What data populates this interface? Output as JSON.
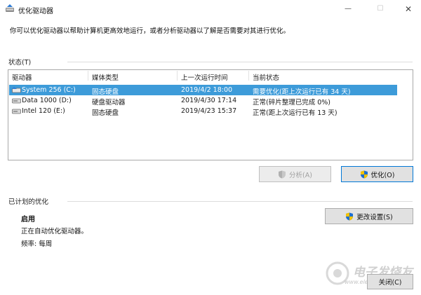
{
  "window": {
    "title": "优化驱动器",
    "controls": {
      "minimize": "—",
      "maximize": "☐",
      "close": "✕"
    }
  },
  "description": "你可以优化驱动器以帮助计算机更高效地运行，或者分析驱动器以了解是否需要对其进行优化。",
  "status": {
    "label": "状态(T)",
    "columns": [
      "驱动器",
      "媒体类型",
      "上一次运行时间",
      "当前状态"
    ],
    "rows": [
      {
        "drive": "System 256 (C:)",
        "media": "固态硬盘",
        "last_run": "2019/4/2 18:00",
        "status": "需要优化(距上次运行已有 34 天)",
        "selected": true
      },
      {
        "drive": "Data 1000 (D:)",
        "media": "硬盘驱动器",
        "last_run": "2019/4/30 17:14",
        "status": "正常(碎片整理已完成 0%)",
        "selected": false
      },
      {
        "drive": "Intel 120 (E:)",
        "media": "固态硬盘",
        "last_run": "2019/4/23 15:37",
        "status": "正常(距上次运行已有 13 天)",
        "selected": false
      }
    ],
    "analyze_label": "分析(A)",
    "optimize_label": "优化(O)"
  },
  "scheduled": {
    "label": "已计划的优化",
    "state": "启用",
    "description": "正在自动优化驱动器。",
    "frequency": "频率: 每周",
    "change_settings_label": "更改设置(S)"
  },
  "close_label": "关闭(C)",
  "watermark": {
    "text": "电子发烧友",
    "sub": "www.elecfans.com"
  },
  "colors": {
    "selection": "#3d9bd9",
    "accent": "#0078d7",
    "shield_blue": "#1e6fd0",
    "shield_yellow": "#f2c200"
  }
}
